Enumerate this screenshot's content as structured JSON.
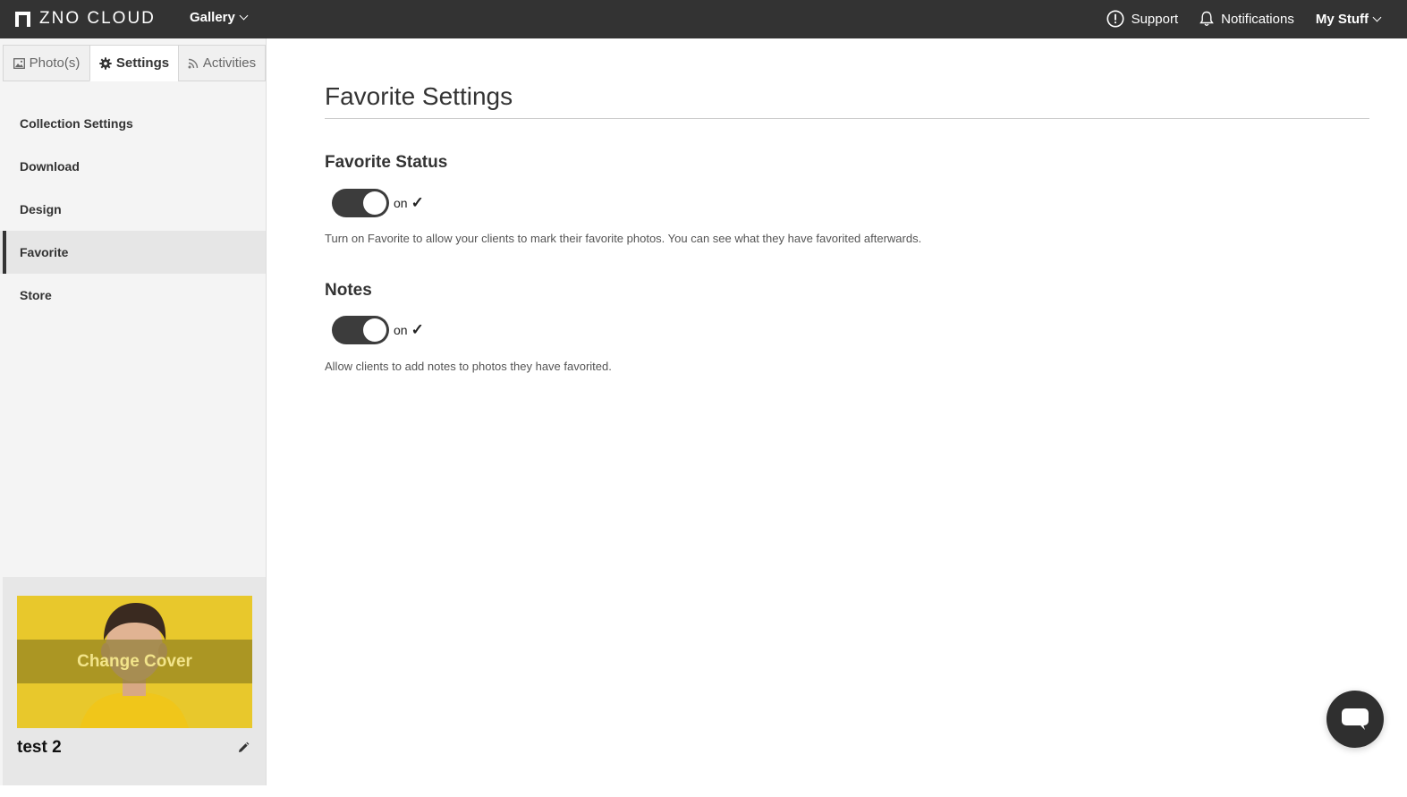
{
  "topbar": {
    "brand": "ZNO CLOUD",
    "gallery_label": "Gallery",
    "support_label": "Support",
    "notifications_label": "Notifications",
    "mystuff_label": "My Stuff"
  },
  "tabs": [
    {
      "label": "Photo(s)",
      "icon": "image-icon"
    },
    {
      "label": "Settings",
      "icon": "gear-icon"
    },
    {
      "label": "Activities",
      "icon": "rss-icon"
    }
  ],
  "sidebar": {
    "items": [
      {
        "label": "Collection Settings"
      },
      {
        "label": "Download"
      },
      {
        "label": "Design"
      },
      {
        "label": "Favorite"
      },
      {
        "label": "Store"
      }
    ],
    "active_item": "Favorite"
  },
  "cover": {
    "overlay_label": "Change Cover",
    "collection_name": "test 2"
  },
  "main": {
    "title": "Favorite Settings",
    "sections": [
      {
        "title": "Favorite Status",
        "toggle_state": "on",
        "description": "Turn on Favorite to allow your clients to mark their favorite photos. You can see what they have favorited afterwards."
      },
      {
        "title": "Notes",
        "toggle_state": "on",
        "description": "Allow clients to add notes to photos they have favorited."
      }
    ]
  },
  "colors": {
    "topbar": "#333333",
    "toggle_on": "#3c3c3c",
    "cover_bg": "#e8c82c",
    "chat_button": "#2f2f2f"
  }
}
